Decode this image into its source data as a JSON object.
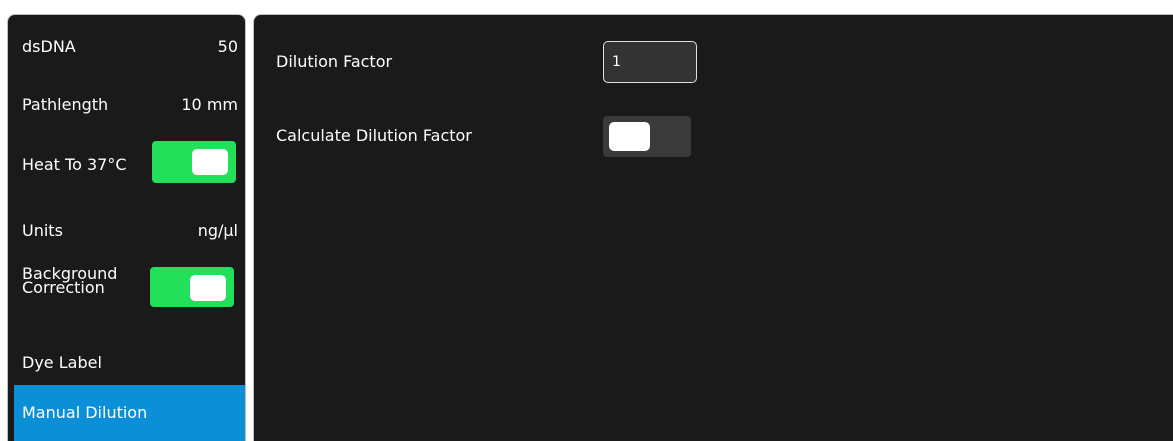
{
  "sidebar": {
    "sample_type": {
      "label": "dsDNA",
      "value": "50"
    },
    "pathlength": {
      "label": "Pathlength",
      "value": "10 mm"
    },
    "heat": {
      "label": "Heat To 37°C",
      "toggle": "on"
    },
    "units": {
      "label": "Units",
      "value": "ng/µl"
    },
    "background_correction": {
      "label_line1": "Background",
      "label_line2": "Correction",
      "toggle": "on"
    },
    "dye_label": {
      "label": "Dye Label"
    },
    "manual_dilution": {
      "label": "Manual Dilution",
      "selected": true
    }
  },
  "main": {
    "dilution_factor": {
      "label": "Dilution Factor",
      "value": "1"
    },
    "calculate_dilution_factor": {
      "label": "Calculate Dilution Factor",
      "toggle": "off"
    }
  },
  "colors": {
    "panel_bg": "#1a1a1a",
    "toggle_on": "#22e05a",
    "toggle_off": "#3a3a3a",
    "selection": "#0b8fd6"
  }
}
